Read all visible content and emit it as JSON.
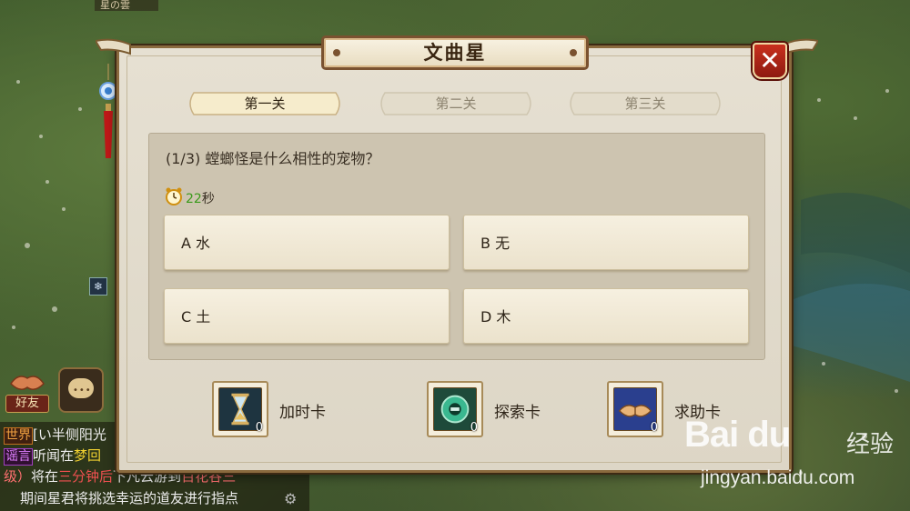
{
  "background": {
    "top_left_tag": "星の雲"
  },
  "dialog": {
    "title": "文曲星",
    "close_label": "✕",
    "tabs": [
      {
        "label": "第一关",
        "active": true
      },
      {
        "label": "第二关",
        "active": false
      },
      {
        "label": "第三关",
        "active": false
      }
    ],
    "question": "(1/3) 螳螂怪是什么相性的宠物？",
    "timer": {
      "value": "22",
      "unit": "秒"
    },
    "answers": [
      {
        "label": "A 水"
      },
      {
        "label": "B 无"
      },
      {
        "label": "C 土"
      },
      {
        "label": "D 木"
      }
    ],
    "cards": [
      {
        "label": "加时卡",
        "count": "0",
        "icon": "hourglass-icon"
      },
      {
        "label": "探索卡",
        "count": "0",
        "icon": "compass-orb-icon"
      },
      {
        "label": "求助卡",
        "count": "0",
        "icon": "handshake-icon"
      }
    ]
  },
  "hud": {
    "friend_label": "好友",
    "chat_icon": "chat-bubble-icon"
  },
  "chat": {
    "line1": {
      "tag": "世界",
      "text": "[い半侧阳光"
    },
    "line2": {
      "tag": "谣言",
      "text": "听闻在",
      "highlight": "梦回"
    },
    "line3": {
      "prefix": "级）",
      "text1": "将在",
      "hl1": "三分钟后",
      "text2": "下凡云游到",
      "hl2": "百花谷三"
    },
    "line4": {
      "text": "期间星君将挑选幸运的道友进行指点"
    }
  },
  "watermark": {
    "logo": "Bai du",
    "cn": "经验",
    "url": "jingyan.baidu.com"
  },
  "colors": {
    "frame": "#8a6a3e",
    "panel": "#ddd6c6",
    "close_red": "#c8301e",
    "timer_green": "#3a9a1a"
  }
}
